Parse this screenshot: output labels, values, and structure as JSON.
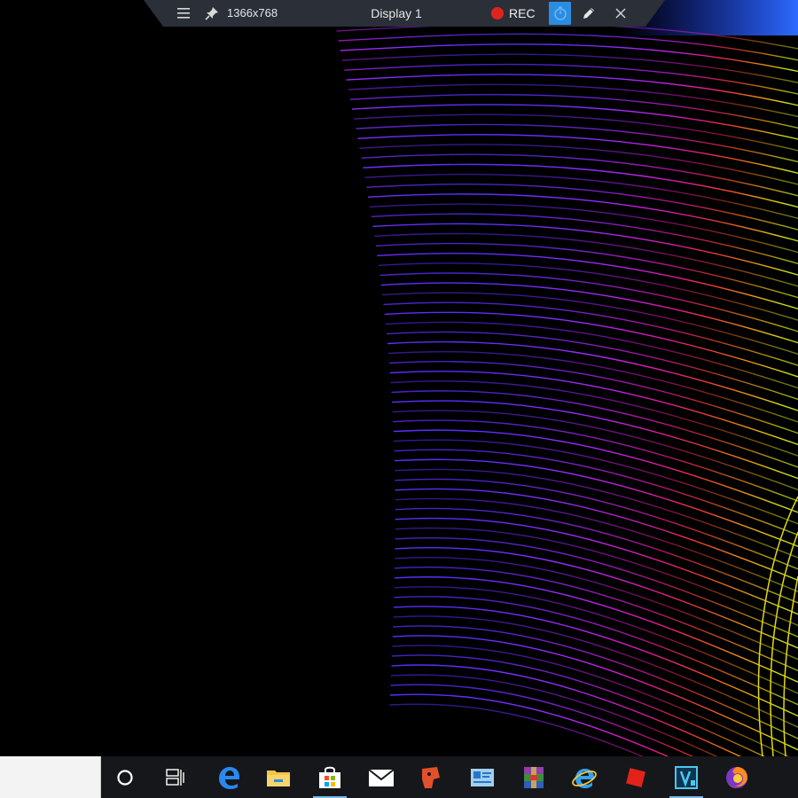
{
  "recorder": {
    "resolution": "1366x768",
    "display": "Display 1",
    "rec_label": "REC",
    "icons": [
      "menu-icon",
      "pin-icon",
      "rec-dot-icon",
      "timer-icon",
      "pen-icon",
      "close-icon"
    ],
    "accent": "#2b8de0",
    "rec_color": "#e0231e"
  },
  "taskbar": {
    "search_value": "",
    "apps": [
      "cortana-circle-icon",
      "task-view-icon",
      "edge-icon",
      "file-explorer-icon",
      "microsoft-store-icon",
      "mail-icon",
      "app-red-icon",
      "contacts-icon",
      "winrar-icon",
      "internet-explorer-icon",
      "roblox-icon",
      "vegas-icon",
      "firefox-icon"
    ]
  }
}
